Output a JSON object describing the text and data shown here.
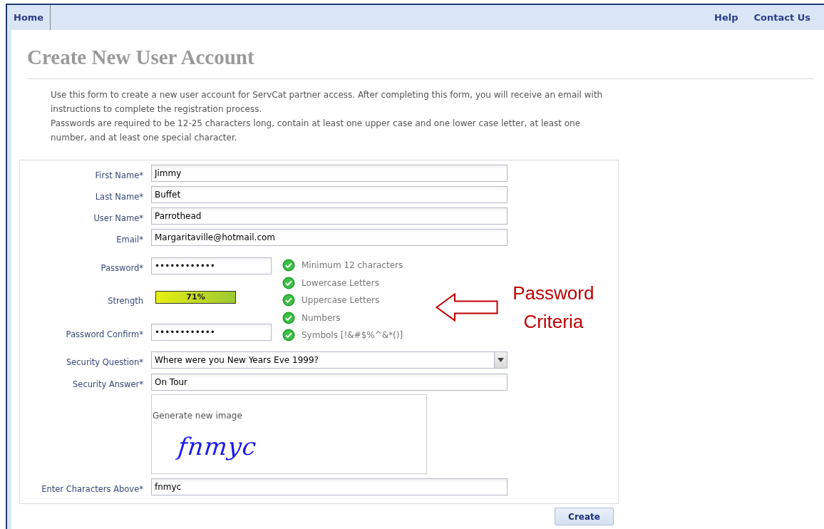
{
  "nav": {
    "left": [
      {
        "label": "Home"
      }
    ],
    "right": [
      {
        "label": "Help"
      },
      {
        "label": "Contact Us"
      }
    ]
  },
  "title": "Create New User Account",
  "intro": [
    "Use this form to create a new user account for ServCat partner access. After completing this form, you will receive an email with instructions to complete the registration process.",
    "Passwords are required to be 12-25 characters long, contain at least one upper case and one lower case letter, at least one number, and at least one special character."
  ],
  "fields_top": [
    {
      "label": "First Name*",
      "value": "Jimmy"
    },
    {
      "label": "Last Name*",
      "value": "Buffet"
    },
    {
      "label": "User Name*",
      "value": "Parrothead"
    },
    {
      "label": "Email*",
      "value": "Margaritaville@hotmail.com"
    }
  ],
  "password": {
    "label": "Password*",
    "value": "••••••••••••"
  },
  "strength": {
    "label": "Strength",
    "reading": "71%"
  },
  "password_confirm": {
    "label": "Password Confirm*",
    "value": "••••••••••••"
  },
  "criteria": [
    {
      "label": "Minimum 12 characters",
      "met": true
    },
    {
      "label": "Lowercase Letters",
      "met": true
    },
    {
      "label": "Uppercase Letters",
      "met": true
    },
    {
      "label": "Numbers",
      "met": true
    },
    {
      "label": "Symbols [!&#$%^&*()]",
      "met": true
    }
  ],
  "annotation": {
    "lines": [
      "Password",
      "Criteria"
    ]
  },
  "security_question": {
    "label": "Security Question*",
    "value": "Where were you New Years Eve 1999?"
  },
  "security_answer": {
    "label": "Security Answer*",
    "value": "On Tour"
  },
  "captcha": {
    "link": "Generate new image",
    "image_text": "fnmyc"
  },
  "captcha_entry": {
    "label": "Enter Characters Above*",
    "value": "fnmyc"
  },
  "create_button": "Create"
}
